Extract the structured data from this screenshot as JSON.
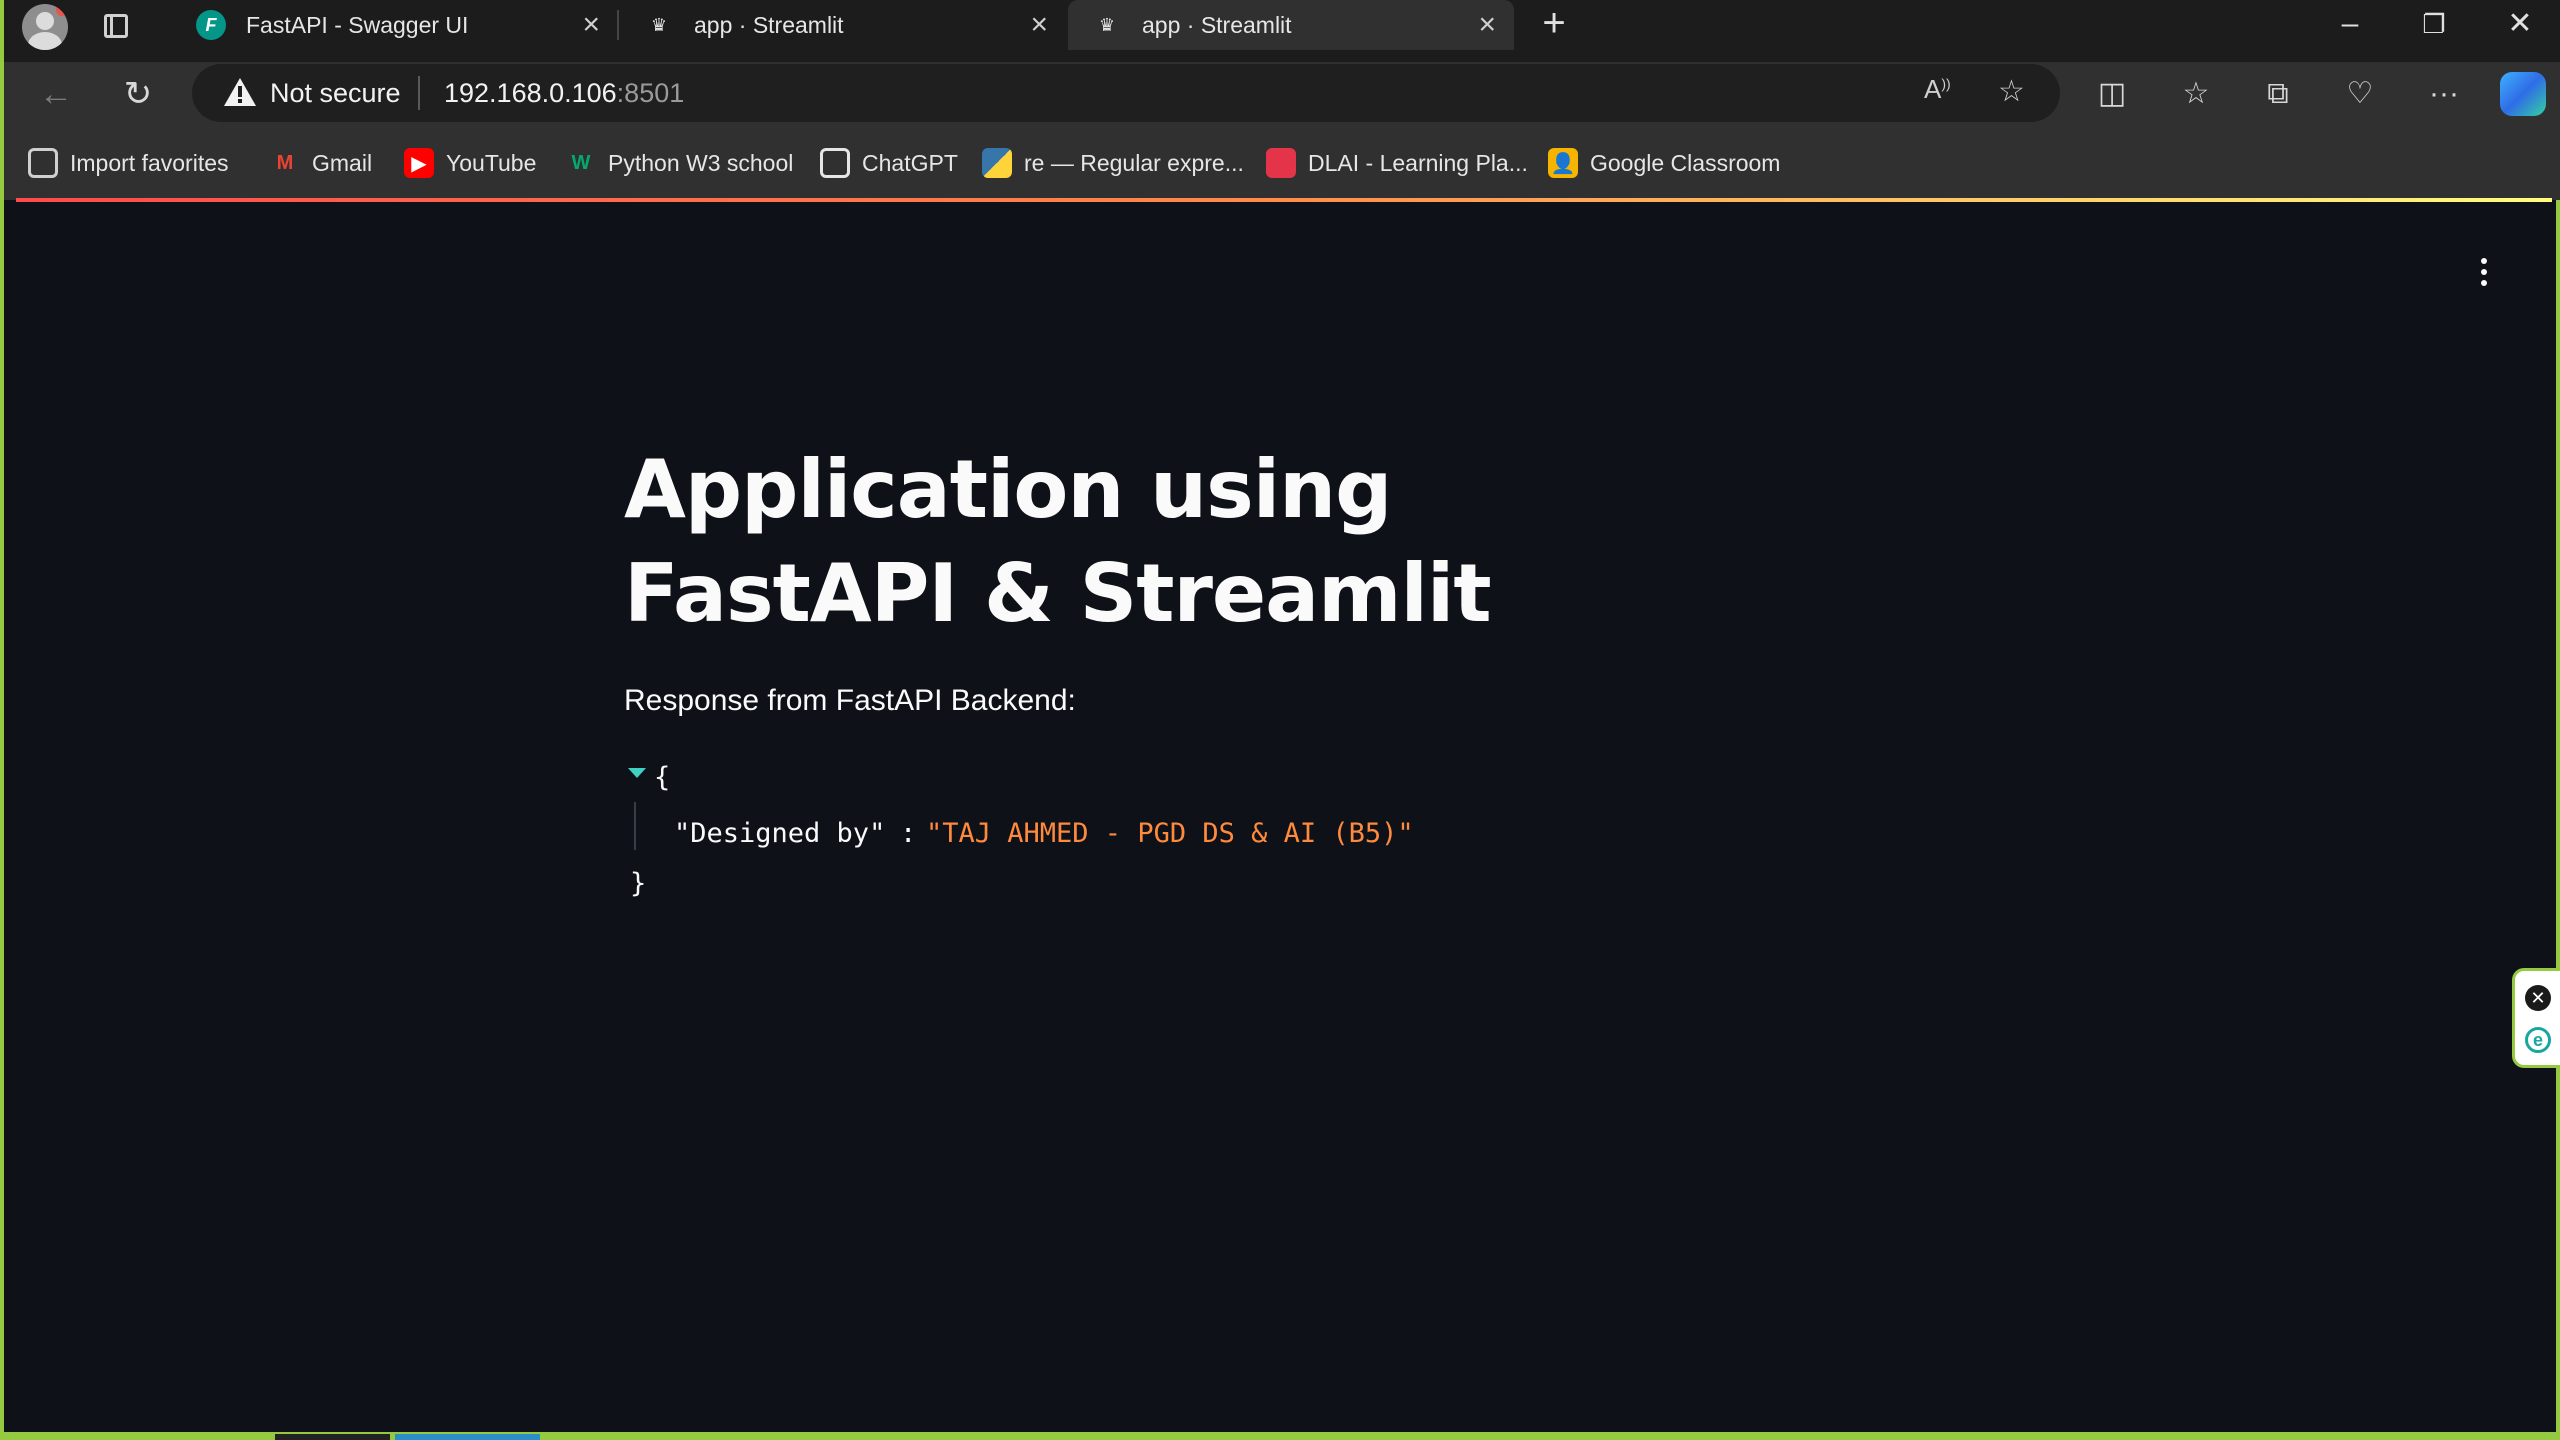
{
  "tabs": [
    {
      "title": "FastAPI - Swagger UI",
      "icon": "fastapi-icon",
      "fav_glyph": "F"
    },
    {
      "title": "app · Streamlit",
      "icon": "streamlit-crown-icon",
      "fav_glyph": "♛"
    },
    {
      "title": "app · Streamlit",
      "icon": "streamlit-crown-icon",
      "fav_glyph": "♛"
    }
  ],
  "address_bar": {
    "security_label": "Not secure",
    "url_host": "192.168.0.106",
    "url_port": ":8501"
  },
  "favorites": [
    {
      "label": "Import favorites",
      "icon": "import-favorites-icon"
    },
    {
      "label": "Gmail",
      "icon": "gmail-icon",
      "glyph": "M"
    },
    {
      "label": "YouTube",
      "icon": "youtube-icon",
      "glyph": "▶"
    },
    {
      "label": "Python W3 school",
      "icon": "w3schools-icon",
      "glyph": "W"
    },
    {
      "label": "ChatGPT",
      "icon": "chatgpt-icon"
    },
    {
      "label": "re — Regular expre...",
      "icon": "python-icon"
    },
    {
      "label": "DLAI - Learning Pla...",
      "icon": "dlai-icon"
    },
    {
      "label": "Google Classroom",
      "icon": "google-classroom-icon",
      "glyph": "👤"
    }
  ],
  "page": {
    "title": "Application using FastAPI & Streamlit",
    "response_label": "Response from FastAPI Backend:",
    "json_open": "{",
    "json_key": "\"Designed by\"",
    "json_colon": ":",
    "json_value": "\"TAJ AHMED - PGD DS & AI (B5)\"",
    "json_close": "}"
  },
  "colors": {
    "accent": "#ff4b4b",
    "background": "#0e1117",
    "json_string": "#ff8a3d",
    "window_border": "#94c940"
  }
}
